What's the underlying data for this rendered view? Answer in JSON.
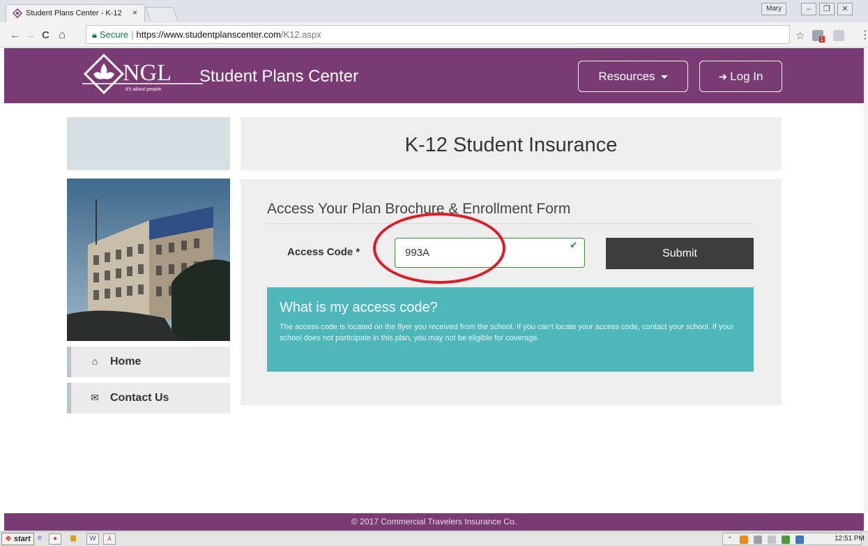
{
  "browser": {
    "tab_title": "Student Plans Center - K-12",
    "tab_close": "×",
    "user_name": "Mary",
    "window_controls": [
      "–",
      "❐",
      "✕"
    ],
    "nav": {
      "back": "←",
      "forward": "→",
      "reload": "C",
      "home": "⌂"
    },
    "secure_label": "Secure",
    "separator": "|",
    "url_host": "https://www.studentplanscenter.com",
    "url_path": "/K12.aspx",
    "bookmark_star": "☆",
    "extension_badge": "1",
    "menu": "⋮"
  },
  "header": {
    "logo_text": "NGL",
    "logo_tagline": "It's about people.",
    "brand": "Student Plans Center",
    "resources_label": "Resources",
    "login_label": "Log In",
    "login_icon": "sign-in-icon"
  },
  "sidebar": {
    "items": [
      {
        "label": "Home",
        "icon": "home-icon",
        "glyph": "⌂"
      },
      {
        "label": "Contact Us",
        "icon": "envelope-icon",
        "glyph": "✉"
      }
    ]
  },
  "main": {
    "title": "K-12 Student Insurance",
    "form_heading": "Access Your Plan Brochure & Enrollment Form",
    "access_label": "Access Code *",
    "access_value": "993A",
    "submit_label": "Submit",
    "help": {
      "title": "What is my access code?",
      "text": "The access code is located on the flyer you received from the school. If you can't locate your access code, contact your school. If your school does not participate in this plan, you may not be eligible for coverage."
    }
  },
  "footer": {
    "copyright": "© 2017 Commercial Travelers Insurance Co."
  },
  "taskbar": {
    "start_label": "start",
    "clock": "12:51 PM"
  },
  "colors": {
    "brand_purple": "#7a3a73",
    "teal": "#4db7ba",
    "submit_dark": "#3d3d3d",
    "valid_green": "#3c8d40",
    "annotation_red": "#e01a22"
  }
}
